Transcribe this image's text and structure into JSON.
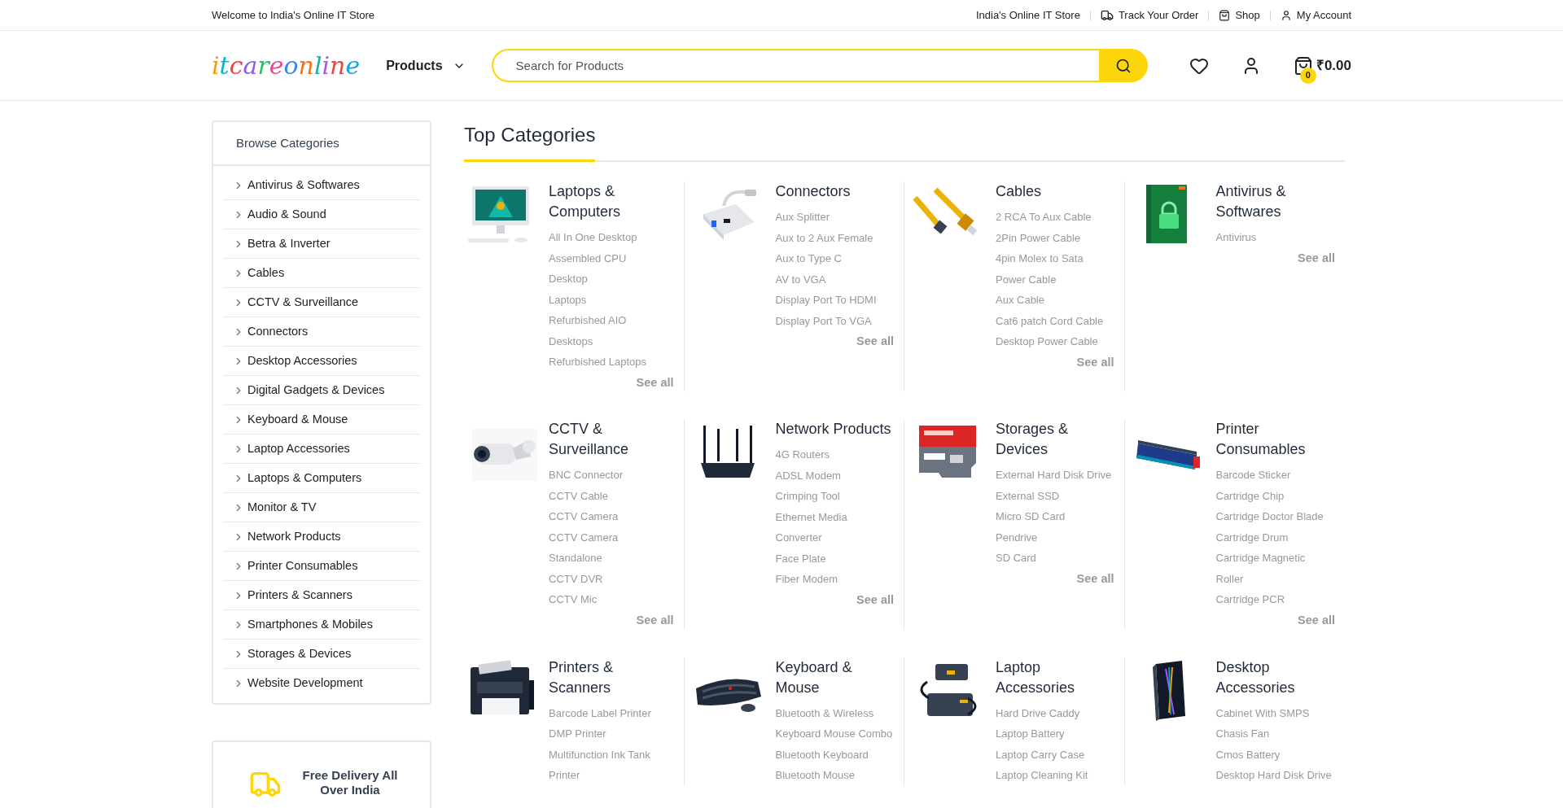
{
  "top_bar": {
    "welcome": "Welcome to India's Online IT Store",
    "links": [
      "India's Online IT Store",
      "Track Your Order",
      "Shop",
      "My Account"
    ]
  },
  "header": {
    "logo": "itcareonline",
    "products_menu": "Products",
    "search": {
      "placeholder": "Search for Products"
    },
    "cart": {
      "count": "0",
      "total": "₹0.00"
    }
  },
  "sidebar": {
    "title": "Browse Categories",
    "items": [
      "Antivirus & Softwares",
      "Audio & Sound",
      "Betra & Inverter",
      "Cables",
      "CCTV & Surveillance",
      "Connectors",
      "Desktop Accessories",
      "Digital Gadgets & Devices",
      "Keyboard & Mouse",
      "Laptop Accessories",
      "Laptops & Computers",
      "Monitor & TV",
      "Network Products",
      "Printer Consumables",
      "Printers & Scanners",
      "Smartphones & Mobiles",
      "Storages & Devices",
      "Website Development"
    ]
  },
  "delivery": {
    "text": "Free Delivery All Over India"
  },
  "top_categories": {
    "title": "Top Categories",
    "categories": [
      {
        "title": "Laptops & Computers",
        "items": [
          "All In One Desktop",
          "Assembled CPU",
          "Desktop",
          "Laptops",
          "Refurbished AIO",
          "Desktops",
          "Refurbished Laptops"
        ],
        "see_all": "See all"
      },
      {
        "title": "Connectors",
        "items": [
          "Aux Splitter",
          "Aux to 2 Aux Female",
          "Aux to Type C",
          "AV to VGA",
          "Display Port To HDMI",
          "Display Port To VGA"
        ],
        "see_all": "See all"
      },
      {
        "title": "Cables",
        "items": [
          "2 RCA To Aux Cable",
          "2Pin Power Cable",
          "4pin Molex to Sata",
          "Power Cable",
          "Aux Cable",
          "Cat6 patch Cord Cable",
          "Desktop Power Cable"
        ],
        "see_all": "See all"
      },
      {
        "title": "Antivirus & Softwares",
        "items": [
          "Antivirus"
        ],
        "see_all": "See all"
      },
      {
        "title": "CCTV & Surveillance",
        "items": [
          "BNC Connector",
          "CCTV Cable",
          "CCTV Camera",
          "CCTV Camera",
          "Standalone",
          "CCTV DVR",
          "CCTV Mic"
        ],
        "see_all": "See all"
      },
      {
        "title": "Network Products",
        "items": [
          "4G Routers",
          "ADSL Modem",
          "Crimping Tool",
          "Ethernet Media",
          "Converter",
          "Face Plate",
          "Fiber Modem"
        ],
        "see_all": "See all"
      },
      {
        "title": "Storages & Devices",
        "items": [
          "External Hard Disk Drive",
          "External SSD",
          "Micro SD Card",
          "Pendrive",
          "SD Card"
        ],
        "see_all": "See all"
      },
      {
        "title": "Printer Consumables",
        "items": [
          "Barcode Sticker",
          "Cartridge Chip",
          "Cartridge Doctor Blade",
          "Cartridge Drum",
          "Cartridge Magnetic",
          "Roller",
          "Cartridge PCR"
        ],
        "see_all": "See all"
      },
      {
        "title": "Printers & Scanners",
        "items": [
          "Barcode Label Printer",
          "DMP Printer",
          "Multifunction Ink Tank",
          "Printer"
        ]
      },
      {
        "title": "Keyboard & Mouse",
        "items": [
          "Bluetooth & Wireless",
          "Keyboard Mouse Combo",
          "Bluetooth Keyboard",
          "Bluetooth Mouse"
        ]
      },
      {
        "title": "Laptop Accessories",
        "items": [
          "Hard Drive Caddy",
          "Laptop Battery",
          "Laptop Carry Case",
          "Laptop Cleaning Kit"
        ]
      },
      {
        "title": "Desktop Accessories",
        "items": [
          "Cabinet With SMPS",
          "Chasis Fan",
          "Cmos Battery",
          "Desktop Hard Disk Drive"
        ]
      }
    ]
  }
}
